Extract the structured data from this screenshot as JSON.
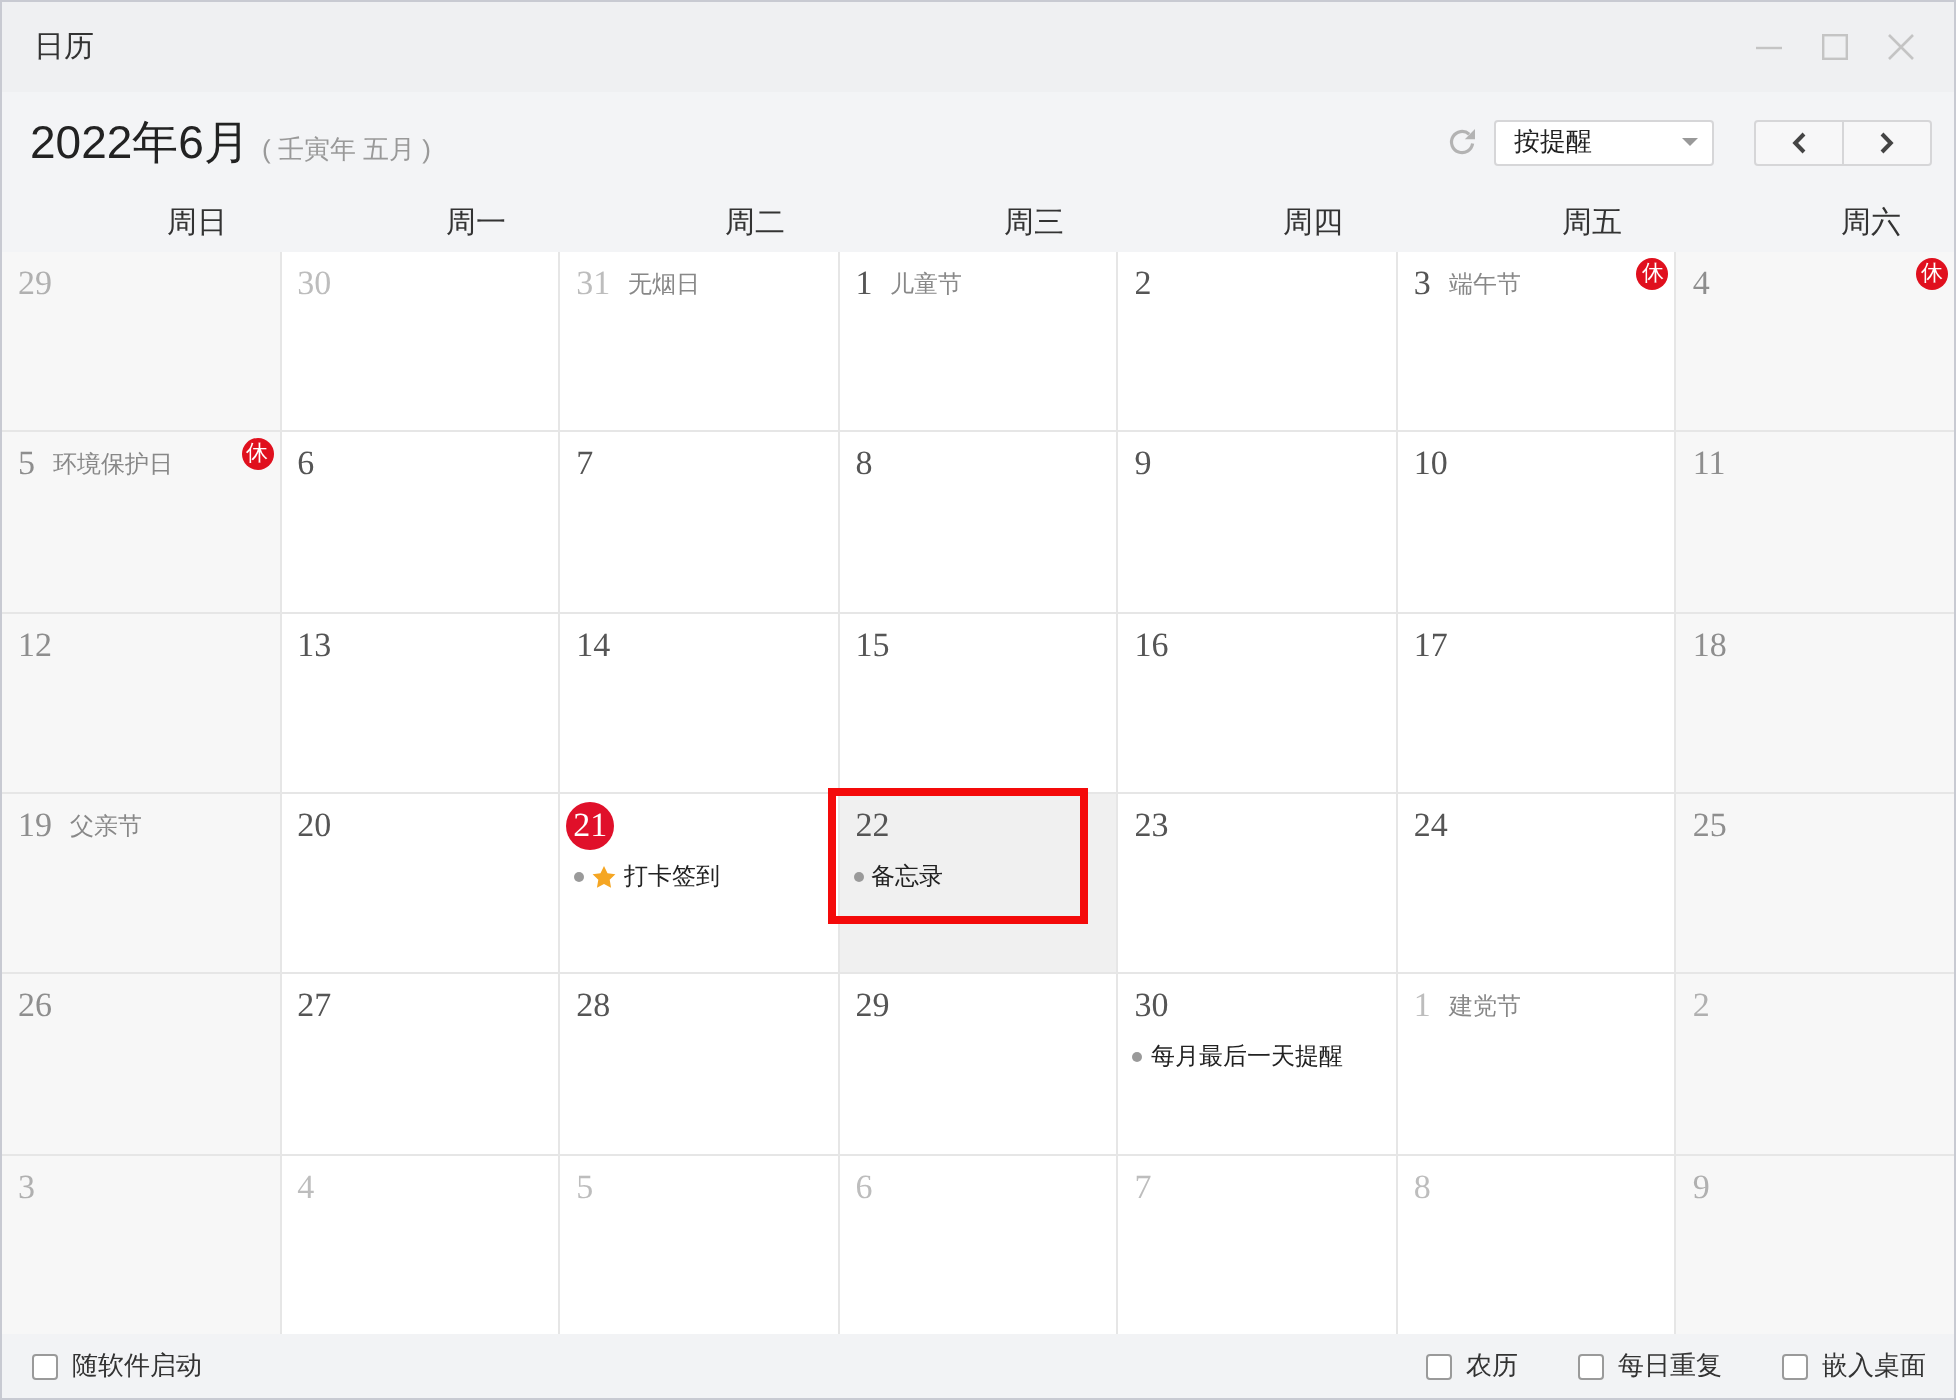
{
  "window": {
    "title": "日历"
  },
  "header": {
    "month": "2022年6月",
    "lunar": "( 壬寅年 五月 )",
    "reminder_filter": {
      "value": "按提醒"
    }
  },
  "weekdays": [
    "周日",
    "周一",
    "周二",
    "周三",
    "周四",
    "周五",
    "周六"
  ],
  "weeks": [
    {
      "days": [
        {
          "number": "29",
          "in_month": false,
          "today": false,
          "selected": false
        },
        {
          "number": "30",
          "in_month": false,
          "today": false,
          "selected": false
        },
        {
          "number": "31",
          "festival": "无烟日",
          "in_month": false,
          "today": false,
          "selected": false
        },
        {
          "number": "1",
          "festival": "儿童节",
          "in_month": true,
          "today": false,
          "selected": false
        },
        {
          "number": "2",
          "in_month": true,
          "today": false,
          "selected": false
        },
        {
          "number": "3",
          "festival": "端午节",
          "badge": "休",
          "in_month": true,
          "today": false,
          "selected": false
        },
        {
          "number": "4",
          "badge": "休",
          "in_month": true,
          "today": false,
          "selected": false
        }
      ]
    },
    {
      "days": [
        {
          "number": "5",
          "festival": "环境保护日",
          "badge": "休",
          "in_month": true,
          "today": false,
          "selected": false
        },
        {
          "number": "6",
          "in_month": true,
          "today": false,
          "selected": false
        },
        {
          "number": "7",
          "in_month": true,
          "today": false,
          "selected": false
        },
        {
          "number": "8",
          "in_month": true,
          "today": false,
          "selected": false
        },
        {
          "number": "9",
          "in_month": true,
          "today": false,
          "selected": false
        },
        {
          "number": "10",
          "in_month": true,
          "today": false,
          "selected": false
        },
        {
          "number": "11",
          "in_month": true,
          "today": false,
          "selected": false
        }
      ]
    },
    {
      "days": [
        {
          "number": "12",
          "in_month": true,
          "today": false,
          "selected": false
        },
        {
          "number": "13",
          "in_month": true,
          "today": false,
          "selected": false
        },
        {
          "number": "14",
          "in_month": true,
          "today": false,
          "selected": false
        },
        {
          "number": "15",
          "in_month": true,
          "today": false,
          "selected": false
        },
        {
          "number": "16",
          "in_month": true,
          "today": false,
          "selected": false
        },
        {
          "number": "17",
          "in_month": true,
          "today": false,
          "selected": false
        },
        {
          "number": "18",
          "in_month": true,
          "today": false,
          "selected": false
        }
      ]
    },
    {
      "days": [
        {
          "number": "19",
          "festival": "父亲节",
          "in_month": true,
          "today": false,
          "selected": false
        },
        {
          "number": "20",
          "in_month": true,
          "today": false,
          "selected": false
        },
        {
          "number": "21",
          "in_month": true,
          "today": true,
          "selected": false,
          "events": [
            {
              "text": "打卡签到",
              "starred": true
            }
          ]
        },
        {
          "number": "22",
          "in_month": true,
          "today": false,
          "selected": true,
          "events": [
            {
              "text": "备忘录",
              "starred": false
            }
          ]
        },
        {
          "number": "23",
          "in_month": true,
          "today": false,
          "selected": false
        },
        {
          "number": "24",
          "in_month": true,
          "today": false,
          "selected": false
        },
        {
          "number": "25",
          "in_month": true,
          "today": false,
          "selected": false
        }
      ]
    },
    {
      "days": [
        {
          "number": "26",
          "in_month": true,
          "today": false,
          "selected": false
        },
        {
          "number": "27",
          "in_month": true,
          "today": false,
          "selected": false
        },
        {
          "number": "28",
          "in_month": true,
          "today": false,
          "selected": false
        },
        {
          "number": "29",
          "in_month": true,
          "today": false,
          "selected": false
        },
        {
          "number": "30",
          "in_month": true,
          "today": false,
          "selected": false,
          "events": [
            {
              "text": "每月最后一天提醒",
              "starred": false
            }
          ]
        },
        {
          "number": "1",
          "festival": "建党节",
          "in_month": false,
          "today": false,
          "selected": false
        },
        {
          "number": "2",
          "in_month": false,
          "today": false,
          "selected": false
        }
      ]
    },
    {
      "days": [
        {
          "number": "3",
          "in_month": false,
          "today": false,
          "selected": false
        },
        {
          "number": "4",
          "in_month": false,
          "today": false,
          "selected": false
        },
        {
          "number": "5",
          "in_month": false,
          "today": false,
          "selected": false
        },
        {
          "number": "6",
          "in_month": false,
          "today": false,
          "selected": false
        },
        {
          "number": "7",
          "in_month": false,
          "today": false,
          "selected": false
        },
        {
          "number": "8",
          "in_month": false,
          "today": false,
          "selected": false
        },
        {
          "number": "9",
          "in_month": false,
          "today": false,
          "selected": false
        }
      ]
    }
  ],
  "footer": {
    "left_options": [
      {
        "label": "随软件启动",
        "checked": false
      }
    ],
    "right_options": [
      {
        "label": "农历",
        "checked": false
      },
      {
        "label": "每日重复",
        "checked": false
      },
      {
        "label": "嵌入桌面",
        "checked": false
      }
    ]
  }
}
